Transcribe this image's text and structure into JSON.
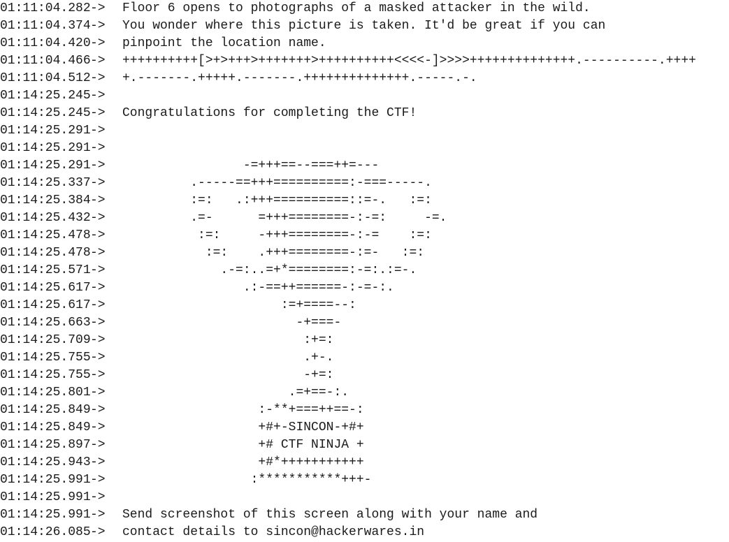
{
  "log": {
    "arrow": "->",
    "lines": [
      {
        "time": "01:11:04.282",
        "text": "Floor 6 opens to photographs of a masked attacker in the wild."
      },
      {
        "time": "01:11:04.374",
        "text": "You wonder where this picture is taken. It'd be great if you can"
      },
      {
        "time": "01:11:04.420",
        "text": "pinpoint the location name."
      },
      {
        "time": "01:11:04.466",
        "text": "++++++++++[>+>+++>+++++++>++++++++++<<<<-]>>>>++++++++++++++.----------.++++"
      },
      {
        "time": "01:11:04.512",
        "text": "+.-------.+++++.-------.++++++++++++++.-----.-."
      },
      {
        "time": "01:14:25.245",
        "text": ""
      },
      {
        "time": "01:14:25.245",
        "text": "Congratulations for completing the CTF!"
      },
      {
        "time": "01:14:25.291",
        "text": ""
      },
      {
        "time": "01:14:25.291",
        "text": ""
      },
      {
        "time": "01:14:25.291",
        "text": "                -=+++==--===++=---"
      },
      {
        "time": "01:14:25.337",
        "text": "         .-----==+++==========:-===-----."
      },
      {
        "time": "01:14:25.384",
        "text": "         :=:   .:+++==========::=-.   :=:"
      },
      {
        "time": "01:14:25.432",
        "text": "         .=-      =+++========-:-=:     -=."
      },
      {
        "time": "01:14:25.478",
        "text": "          :=:     -+++========-:-=    :=:"
      },
      {
        "time": "01:14:25.478",
        "text": "           :=:    .+++========-:=-   :=:"
      },
      {
        "time": "01:14:25.571",
        "text": "             .-=:..=+*========:-=:.:=-."
      },
      {
        "time": "01:14:25.617",
        "text": "                .:-==++======-:-=-:."
      },
      {
        "time": "01:14:25.617",
        "text": "                     :=+====--:"
      },
      {
        "time": "01:14:25.663",
        "text": "                       -+===-"
      },
      {
        "time": "01:14:25.709",
        "text": "                        :+=:"
      },
      {
        "time": "01:14:25.755",
        "text": "                        .+-."
      },
      {
        "time": "01:14:25.755",
        "text": "                        -+=:"
      },
      {
        "time": "01:14:25.801",
        "text": "                      .=+==-:."
      },
      {
        "time": "01:14:25.849",
        "text": "                  :-**+===++==-:"
      },
      {
        "time": "01:14:25.849",
        "text": "                  +#+-SINCON-+#+"
      },
      {
        "time": "01:14:25.897",
        "text": "                  +# CTF NINJA +"
      },
      {
        "time": "01:14:25.943",
        "text": "                  +#*+++++++++++"
      },
      {
        "time": "01:14:25.991",
        "text": "                 :***********+++-"
      },
      {
        "time": "01:14:25.991",
        "text": ""
      },
      {
        "time": "01:14:25.991",
        "text": "Send screenshot of this screen along with your name and"
      },
      {
        "time": "01:14:26.085",
        "text": "contact details to sincon@hackerwares.in"
      }
    ]
  }
}
